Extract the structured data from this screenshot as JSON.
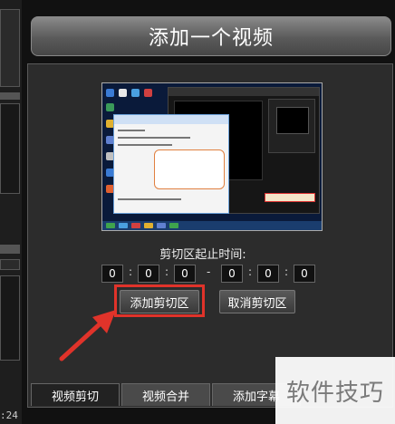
{
  "header": {
    "title": "添加一个视频"
  },
  "left_strip": {
    "time_text": ":24"
  },
  "cut_range": {
    "label": "剪切区起止时间:",
    "start": [
      "0",
      "0",
      "0"
    ],
    "end": [
      "0",
      "0",
      "0"
    ],
    "dash": "-"
  },
  "buttons": {
    "add_cut": "添加剪切区",
    "cancel_cut": "取消剪切区"
  },
  "tabs": [
    {
      "label": "视频剪切"
    },
    {
      "label": "视频合并"
    },
    {
      "label": "添加字幕"
    }
  ],
  "watermark": {
    "text": "软件技巧"
  },
  "colors": {
    "highlight": "#e0332a",
    "arrow": "#e0332a"
  }
}
